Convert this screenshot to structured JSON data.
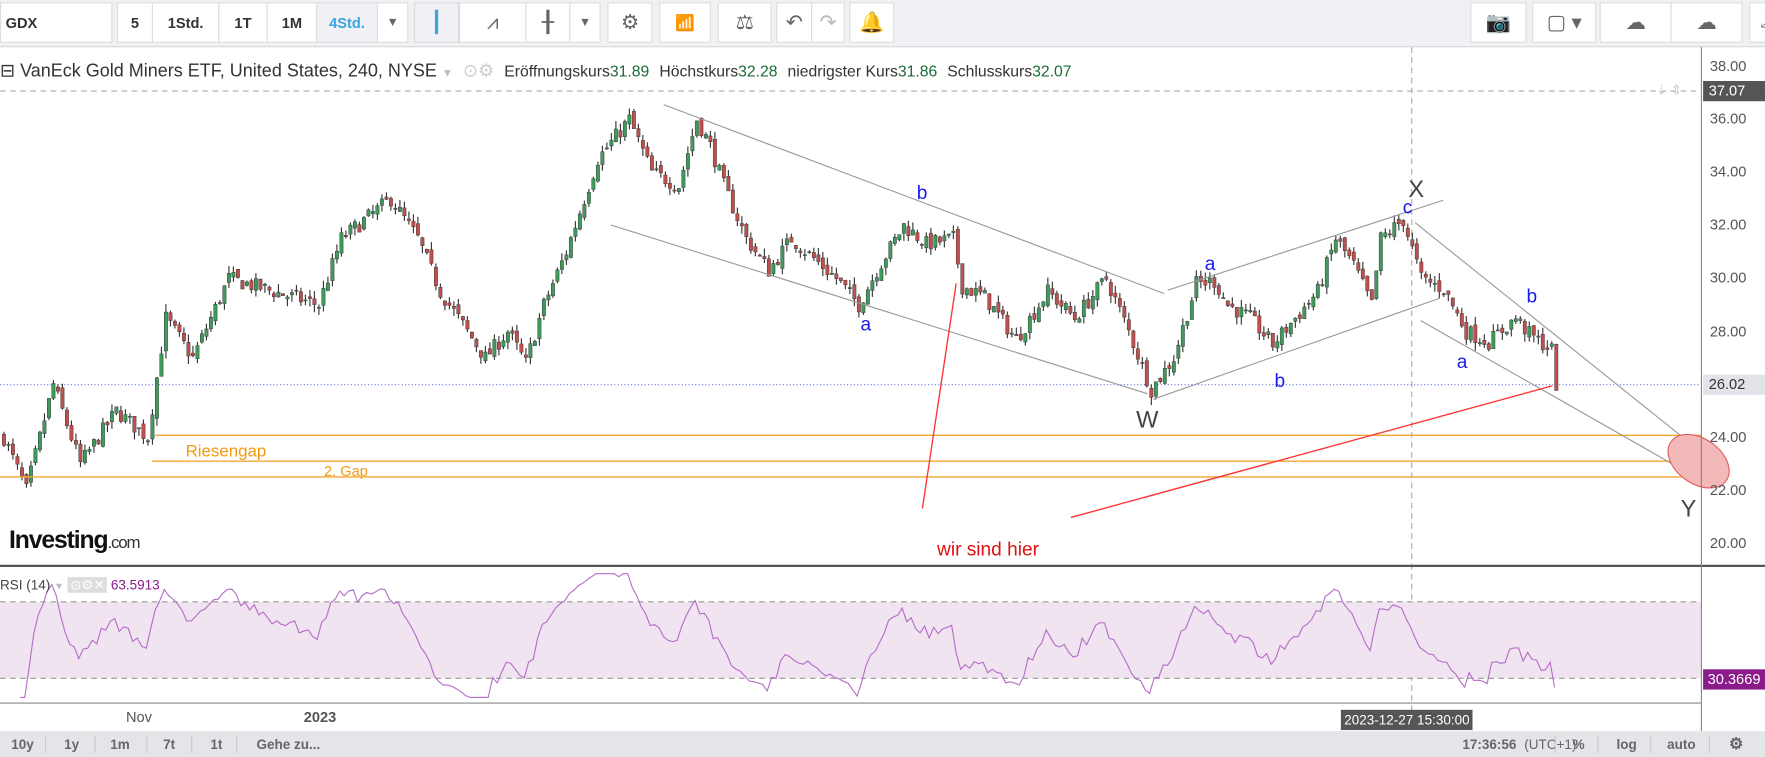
{
  "toolbar": {
    "symbol": "GDX",
    "intervals": [
      "5",
      "1Std.",
      "1T",
      "1M",
      "4Std."
    ],
    "active_interval": "4Std."
  },
  "legend": {
    "title": "VanEck Gold Miners ETF, United States, 240, NYSE",
    "open_label": "Eröffnungskurs",
    "open": "31.89",
    "high_label": "Höchstkurs",
    "high": "32.28",
    "low_label": "niedrigster Kurs",
    "low": "31.86",
    "close_label": "Schlusskurs",
    "close": "32.07"
  },
  "rsi": {
    "label": "RSI (14)",
    "value": "63.5913",
    "marker": "30.3669"
  },
  "markers": {
    "crosshair_price": "37.07",
    "last_price": "26.02",
    "crosshair_time": "2023-12-27 15:30:00"
  },
  "bottom": {
    "ranges": [
      "10y",
      "1y",
      "1m",
      "7t",
      "1t"
    ],
    "goto": "Gehe zu...",
    "clock": "17:36:56",
    "tz": "(UTC+1)",
    "pct": "%",
    "log": "log",
    "auto": "auto"
  },
  "logo": "Investing.com",
  "chart_data": {
    "type": "candlestick",
    "ylim": [
      19,
      39
    ],
    "yticks": [
      "38.00",
      "36.00",
      "34.00",
      "32.00",
      "30.00",
      "28.00",
      "26.00",
      "24.00",
      "22.00",
      "20.00"
    ],
    "xticks": [
      "Nov",
      "2023"
    ],
    "price_path": [
      [
        0,
        24
      ],
      [
        5,
        22
      ],
      [
        11,
        26
      ],
      [
        17,
        23
      ],
      [
        25,
        25
      ],
      [
        32,
        24
      ],
      [
        36,
        28.5
      ],
      [
        42,
        27
      ],
      [
        50,
        30
      ],
      [
        60,
        29.5
      ],
      [
        70,
        29
      ],
      [
        75,
        31.5
      ],
      [
        86,
        33
      ],
      [
        92,
        31.5
      ],
      [
        97,
        29.5
      ],
      [
        107,
        27
      ],
      [
        112,
        28
      ],
      [
        116,
        26.8
      ],
      [
        120,
        29
      ],
      [
        125,
        31
      ],
      [
        132,
        34.5
      ],
      [
        139,
        36
      ],
      [
        144,
        34
      ],
      [
        150,
        33.5
      ],
      [
        154,
        36
      ],
      [
        157,
        35
      ],
      [
        160,
        33.5
      ],
      [
        165,
        31.5
      ],
      [
        170,
        30.3
      ],
      [
        175,
        31.5
      ],
      [
        185,
        30
      ],
      [
        190,
        29
      ],
      [
        194,
        30.3
      ],
      [
        200,
        32
      ],
      [
        205,
        31.3
      ],
      [
        211,
        31.5
      ],
      [
        213,
        29.7
      ],
      [
        218,
        29.3
      ],
      [
        225,
        27.7
      ],
      [
        232,
        29.5
      ],
      [
        238,
        28.5
      ],
      [
        245,
        30
      ],
      [
        250,
        28
      ],
      [
        255,
        25.8
      ],
      [
        260,
        27
      ],
      [
        265,
        29.8
      ],
      [
        269,
        29.9
      ],
      [
        272,
        29
      ],
      [
        277,
        28.5
      ],
      [
        282,
        27.5
      ],
      [
        287,
        28.5
      ],
      [
        292,
        29.5
      ],
      [
        296,
        31.5
      ],
      [
        300,
        30.5
      ],
      [
        304,
        29
      ],
      [
        306,
        31.5
      ],
      [
        311,
        32.2
      ],
      [
        315,
        30
      ],
      [
        320,
        29.6
      ],
      [
        325,
        28
      ],
      [
        330,
        27.6
      ],
      [
        336,
        28.5
      ],
      [
        339,
        27.9
      ],
      [
        344,
        27.3
      ],
      [
        345,
        26
      ]
    ],
    "annotations": {
      "waves": [
        "b",
        "a",
        "W",
        "a",
        "b",
        "X",
        "c",
        "a",
        "b",
        "Y"
      ],
      "note": "wir sind hier",
      "gap1": "Riesengap",
      "gap2": "2. Gap",
      "gap_levels": [
        24.08,
        23.1,
        22.5
      ]
    }
  }
}
